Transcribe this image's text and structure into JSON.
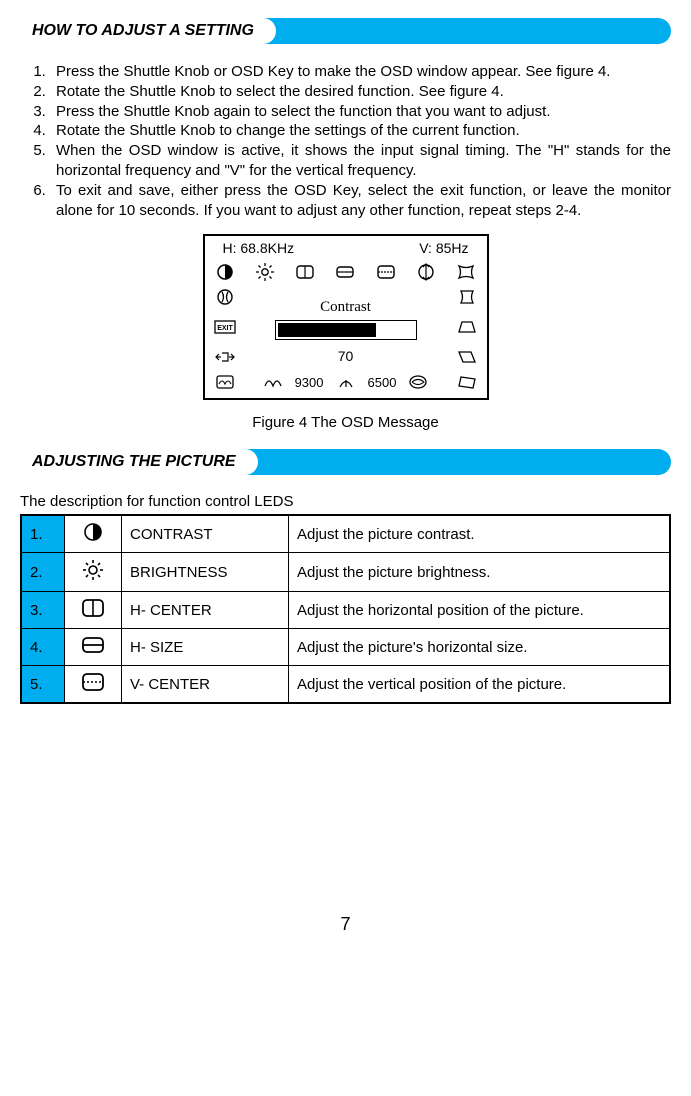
{
  "section1": {
    "title": "HOW TO ADJUST A SETTING"
  },
  "steps": {
    "s1": "Press the Shuttle Knob or OSD Key to make the OSD window appear. See figure 4.",
    "s2": "Rotate the Shuttle Knob to select the desired function. See figure 4.",
    "s3": "Press the Shuttle Knob again to select the function that you want to adjust.",
    "s4": "Rotate the Shuttle Knob to change the settings of the current function.",
    "s5": "When the OSD window is active, it shows the input signal  timing. The  \"H\" stands  for the horizontal frequency and \"V\" for the vertical frequency.",
    "s6": "To exit and save, either press the OSD Key, select the exit function, or leave the monitor alone for 10 seconds. If you want to adjust any other function, repeat steps 2-4."
  },
  "osd": {
    "h": "H: 68.8KHz",
    "v": "V: 85Hz",
    "label": "Contrast",
    "value": "70",
    "k1": "9300",
    "k2": "6500"
  },
  "figcap": "Figure 4     The  OSD  Message",
  "section2": {
    "title": "ADJUSTING THE PICTURE"
  },
  "leds_intro": "The description for function control LEDS",
  "leds": {
    "r1": {
      "n": "1.",
      "name": "CONTRAST",
      "desc": "Adjust the picture contrast."
    },
    "r2": {
      "n": "2.",
      "name": "BRIGHTNESS",
      "desc": "Adjust the picture brightness."
    },
    "r3": {
      "n": "3.",
      "name": "H- CENTER",
      "desc": "Adjust the horizontal position of the picture."
    },
    "r4": {
      "n": "4.",
      "name": "H- SIZE",
      "desc": "Adjust the picture's horizontal size."
    },
    "r5": {
      "n": "5.",
      "name": "V- CENTER",
      "desc": "Adjust the vertical position of the picture."
    }
  },
  "page": "7"
}
